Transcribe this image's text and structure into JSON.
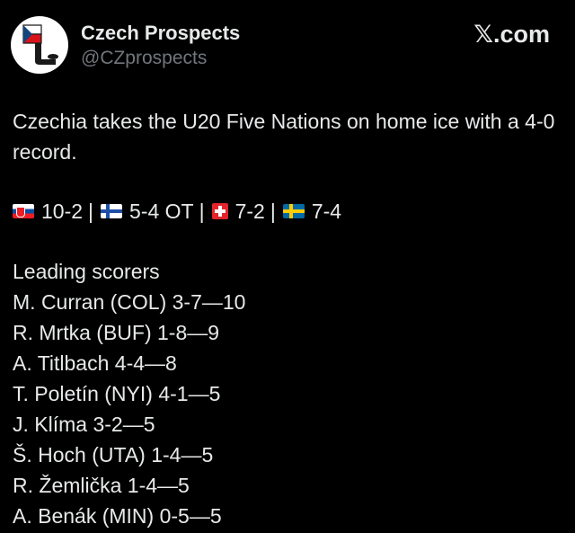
{
  "account": {
    "display_name": "Czech Prospects",
    "handle": "@CZprospects",
    "avatar_icon": "czech-hockey-stick-logo-icon"
  },
  "site": {
    "logo_x": "𝕏",
    "logo_text": ".com"
  },
  "tweet": {
    "intro": "Czechia takes the U20 Five Nations on home ice with a 4-0 record.",
    "results": [
      {
        "flag_icon": "slovakia-flag-icon",
        "score": "10-2",
        "separator": "|"
      },
      {
        "flag_icon": "finland-flag-icon",
        "score": "5-4 OT",
        "separator": "|"
      },
      {
        "flag_icon": "switzerland-flag-icon",
        "score": "7-2",
        "separator": "|"
      },
      {
        "flag_icon": "sweden-flag-icon",
        "score": "7-4",
        "separator": ""
      }
    ],
    "scorers_heading": "Leading scorers",
    "scorers": [
      "M. Curran (COL) 3-7—10",
      "R. Mrtka (BUF) 1-8—9",
      "A. Titlbach 4-4—8",
      "T. Poletín (NYI) 4-1—5",
      "J. Klíma 3-2—5",
      "Š. Hoch (UTA) 1-4—5",
      "R. Žemlička 1-4—5",
      "A. Benák (MIN) 0-5—5"
    ]
  },
  "colors": {
    "background": "#000000",
    "text": "#e7e9ea",
    "secondary_text": "#71767b"
  }
}
